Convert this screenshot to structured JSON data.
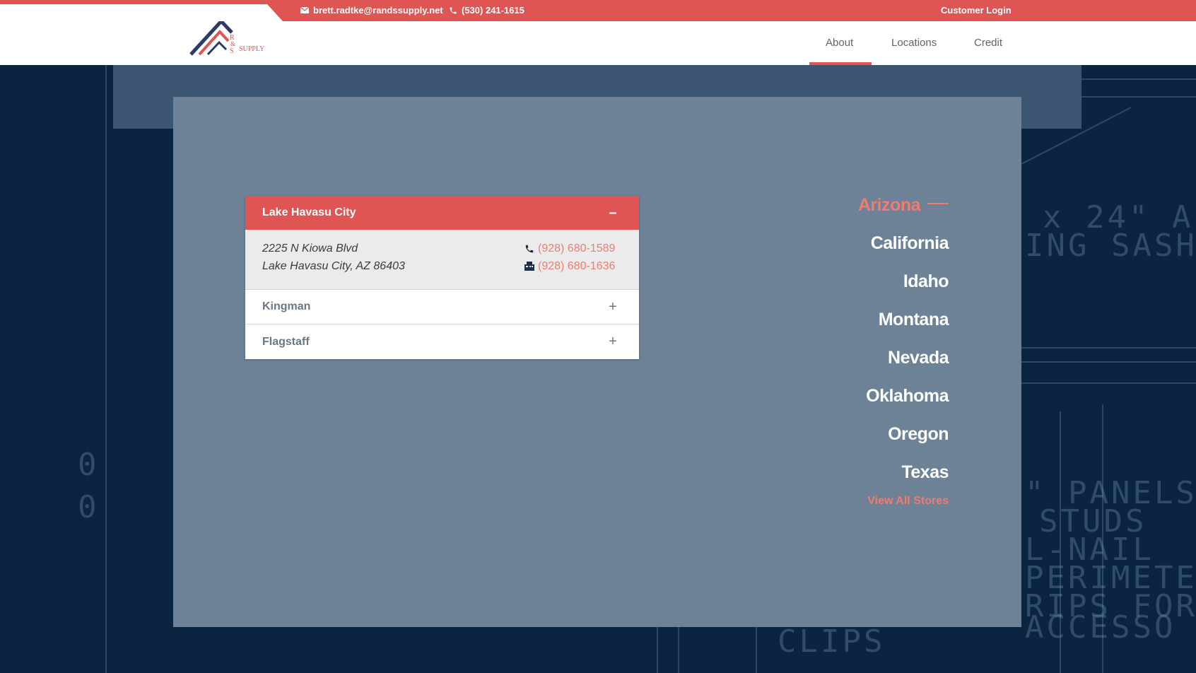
{
  "topbar": {
    "email": "brett.radtke@randssupply.net",
    "phone": "(530) 241-1615",
    "login": "Customer Login"
  },
  "brand": {
    "logo_letters": "R & S",
    "logo_word": "SUPPLY",
    "accent_color": "#df5553",
    "navy_color": "#2e3a66"
  },
  "nav": {
    "items": [
      {
        "label": "About",
        "active": true
      },
      {
        "label": "Locations",
        "active": false
      },
      {
        "label": "Credit",
        "active": false
      }
    ]
  },
  "accordion": {
    "open_store": {
      "name": "Lake Havasu City",
      "toggle": "–",
      "address_line1": "2225 N Kiowa Blvd",
      "address_line2": "Lake Havasu City, AZ 86403",
      "phone": "(928) 680-1589",
      "fax": "(928) 680-1636"
    },
    "stores": [
      {
        "name": "Kingman",
        "toggle": "+"
      },
      {
        "name": "Flagstaff",
        "toggle": "+"
      }
    ]
  },
  "states": {
    "items": [
      "Arizona",
      "California",
      "Idaho",
      "Montana",
      "Nevada",
      "Oklahoma",
      "Oregon",
      "Texas"
    ],
    "active": "Arizona",
    "view_all": "View All Stores"
  }
}
